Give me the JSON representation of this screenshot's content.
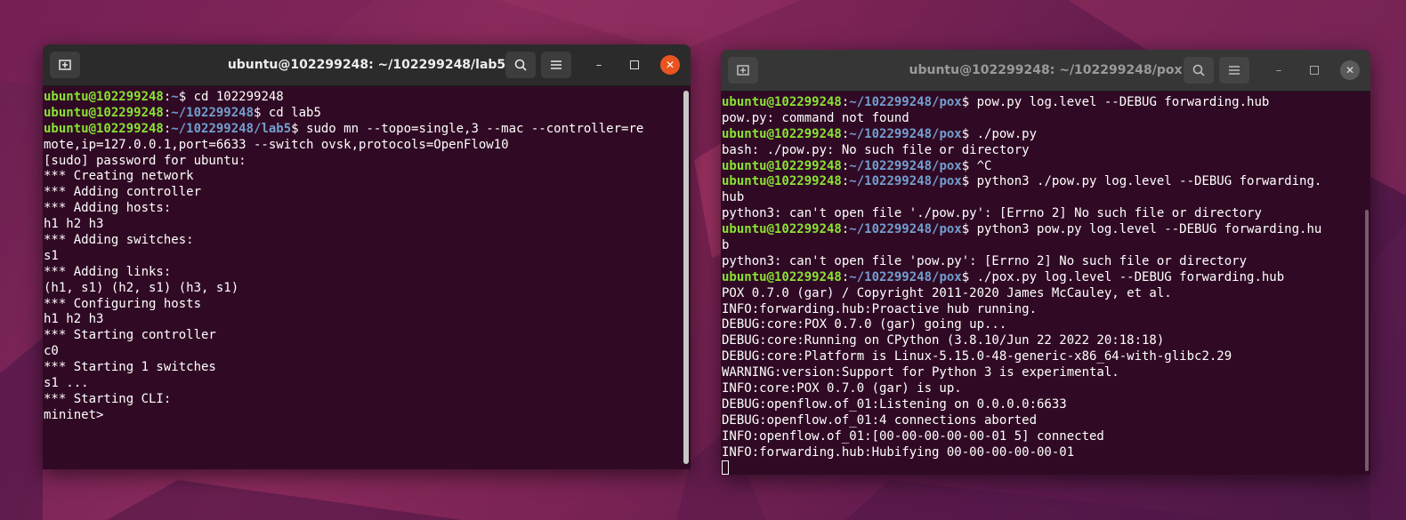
{
  "left_terminal": {
    "title": "ubuntu@102299248: ~/102299248/lab5",
    "icons": {
      "new_tab": "new-tab-icon",
      "search": "search-icon",
      "menu": "hamburger-menu-icon",
      "minimize": "minimize-icon",
      "maximize": "maximize-icon",
      "close": "close-icon"
    },
    "lines": [
      {
        "user": "ubuntu@102299248",
        "path": "~",
        "cmd": "$ cd 102299248"
      },
      {
        "user": "ubuntu@102299248",
        "path": "~/102299248",
        "cmd": "$ cd lab5"
      },
      {
        "user": "ubuntu@102299248",
        "path": "~/102299248/lab5",
        "cmd": "$ sudo mn --topo=single,3 --mac --controller=re"
      },
      {
        "text": "mote,ip=127.0.0.1,port=6633 --switch ovsk,protocols=OpenFlow10"
      },
      {
        "text": "[sudo] password for ubuntu:"
      },
      {
        "text": "*** Creating network"
      },
      {
        "text": "*** Adding controller"
      },
      {
        "text": "*** Adding hosts:"
      },
      {
        "text": "h1 h2 h3"
      },
      {
        "text": "*** Adding switches:"
      },
      {
        "text": "s1"
      },
      {
        "text": "*** Adding links:"
      },
      {
        "text": "(h1, s1) (h2, s1) (h3, s1)"
      },
      {
        "text": "*** Configuring hosts"
      },
      {
        "text": "h1 h2 h3"
      },
      {
        "text": "*** Starting controller"
      },
      {
        "text": "c0"
      },
      {
        "text": "*** Starting 1 switches"
      },
      {
        "text": "s1 ..."
      },
      {
        "text": "*** Starting CLI:"
      },
      {
        "text": "mininet>"
      }
    ]
  },
  "right_terminal": {
    "title": "ubuntu@102299248: ~/102299248/pox",
    "icons": {
      "new_tab": "new-tab-icon",
      "search": "search-icon",
      "menu": "hamburger-menu-icon",
      "minimize": "minimize-icon",
      "maximize": "maximize-icon",
      "close": "close-icon"
    },
    "lines": [
      {
        "user": "ubuntu@102299248",
        "path": "~/102299248/pox",
        "cmd": "$ pow.py log.level --DEBUG forwarding.hub"
      },
      {
        "text": "pow.py: command not found"
      },
      {
        "user": "ubuntu@102299248",
        "path": "~/102299248/pox",
        "cmd": "$ ./pow.py"
      },
      {
        "text": "bash: ./pow.py: No such file or directory"
      },
      {
        "user": "ubuntu@102299248",
        "path": "~/102299248/pox",
        "cmd": "$ ^C"
      },
      {
        "user": "ubuntu@102299248",
        "path": "~/102299248/pox",
        "cmd": "$ python3 ./pow.py log.level --DEBUG forwarding."
      },
      {
        "text": "hub"
      },
      {
        "text": "python3: can't open file './pow.py': [Errno 2] No such file or directory"
      },
      {
        "user": "ubuntu@102299248",
        "path": "~/102299248/pox",
        "cmd": "$ python3 pow.py log.level --DEBUG forwarding.hu"
      },
      {
        "text": "b"
      },
      {
        "text": "python3: can't open file 'pow.py': [Errno 2] No such file or directory"
      },
      {
        "user": "ubuntu@102299248",
        "path": "~/102299248/pox",
        "cmd": "$ ./pox.py log.level --DEBUG forwarding.hub"
      },
      {
        "text": "POX 0.7.0 (gar) / Copyright 2011-2020 James McCauley, et al."
      },
      {
        "text": "INFO:forwarding.hub:Proactive hub running."
      },
      {
        "text": "DEBUG:core:POX 0.7.0 (gar) going up..."
      },
      {
        "text": "DEBUG:core:Running on CPython (3.8.10/Jun 22 2022 20:18:18)"
      },
      {
        "text": "DEBUG:core:Platform is Linux-5.15.0-48-generic-x86_64-with-glibc2.29"
      },
      {
        "text": "WARNING:version:Support for Python 3 is experimental."
      },
      {
        "text": "INFO:core:POX 0.7.0 (gar) is up."
      },
      {
        "text": "DEBUG:openflow.of_01:Listening on 0.0.0.0:6633"
      },
      {
        "text": "DEBUG:openflow.of_01:4 connections aborted"
      },
      {
        "text": "INFO:openflow.of_01:[00-00-00-00-00-01 5] connected"
      },
      {
        "text": "INFO:forwarding.hub:Hubifying 00-00-00-00-00-01"
      },
      {
        "text": "",
        "cursor": true
      }
    ]
  },
  "colors": {
    "terminal_bg": "#300a24",
    "prompt_user": "#8ae234",
    "prompt_path": "#729fcf",
    "close_active": "#e95420"
  }
}
